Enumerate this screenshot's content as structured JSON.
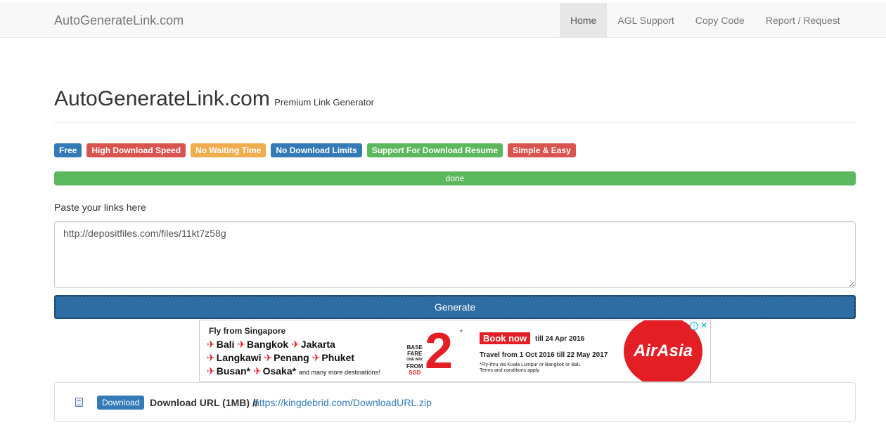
{
  "navbar": {
    "brand": "AutoGenerateLink.com",
    "items": [
      {
        "label": "Home",
        "active": true
      },
      {
        "label": "AGL Support",
        "active": false
      },
      {
        "label": "Copy Code",
        "active": false
      },
      {
        "label": "Report / Request",
        "active": false
      }
    ]
  },
  "header": {
    "title": "AutoGenerateLink.com",
    "subtitle": "Premium Link Generator"
  },
  "labels": [
    {
      "text": "Free",
      "color": "#337ab7"
    },
    {
      "text": "High Download Speed",
      "color": "#d9534f"
    },
    {
      "text": "No Waiting Time",
      "color": "#f0ad4e"
    },
    {
      "text": "No Download Limits",
      "color": "#337ab7"
    },
    {
      "text": "Support For Download Resume",
      "color": "#5cb85c"
    },
    {
      "text": "Simple & Easy",
      "color": "#d9534f"
    }
  ],
  "progress": {
    "text": "done",
    "percent": 100
  },
  "form": {
    "paste_label": "Paste your links here",
    "links_value": "http://depositfiles.com/files/11kt7z58g",
    "generate_label": "Generate"
  },
  "ad": {
    "heading": "Fly from Singapore",
    "row1": [
      "Bali",
      "Bangkok",
      "Jakarta"
    ],
    "row2": [
      "Langkawi",
      "Penang",
      "Phuket"
    ],
    "row3": [
      "Busan*",
      "Osaka*"
    ],
    "row3_more": "and many more destinations!",
    "fare_lines": [
      "BASE",
      "FARE",
      "ONE WAY",
      "FROM"
    ],
    "currency": "SGD",
    "price": "2",
    "star": "*",
    "book_now": "Book now",
    "till": "till 24 Apr 2016",
    "travel": "Travel from 1 Oct 2016 till 22 May 2017",
    "fine1": "*Fly-thru via Kuala Lumpur or Bangkok or Bali.",
    "fine2": "Terms and conditions apply.",
    "logo": "AirAsia"
  },
  "result": {
    "button": "Download",
    "text": "Download URL (1MB) //",
    "link": "https://kingdebrid.com/DownloadURL.zip"
  }
}
